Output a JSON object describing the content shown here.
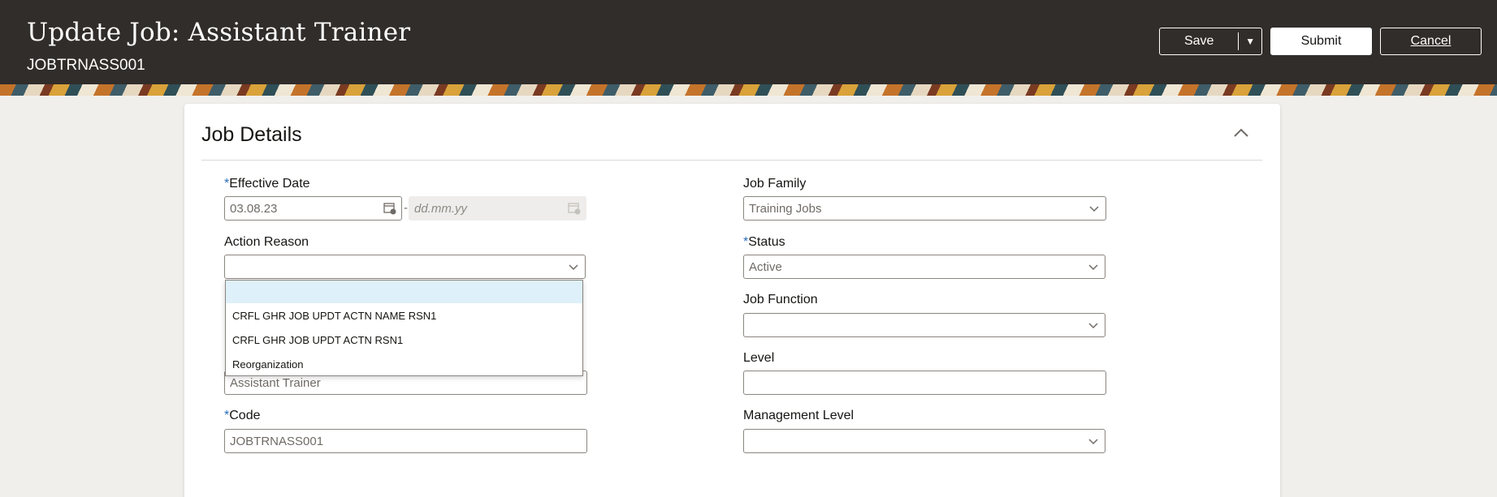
{
  "header": {
    "title": "Update Job: Assistant Trainer",
    "subtitle": "JOBTRNASS001",
    "save_label": "Save",
    "submit_label": "Submit",
    "cancel_label": "Cancel"
  },
  "section": {
    "title": "Job Details"
  },
  "form": {
    "effective_date": {
      "label": "Effective Date",
      "required": "*",
      "value": "03.08.23",
      "end_placeholder": "dd.mm.yy"
    },
    "action_reason": {
      "label": "Action Reason",
      "value": ""
    },
    "name": {
      "value": "Assistant Trainer"
    },
    "code": {
      "label": "Code",
      "required": "*",
      "value": "JOBTRNASS001"
    },
    "job_family": {
      "label": "Job Family",
      "value": "Training Jobs"
    },
    "status": {
      "label": "Status",
      "required": "*",
      "value": "Active"
    },
    "job_function": {
      "label": "Job Function",
      "value": ""
    },
    "level": {
      "label": "Level",
      "value": ""
    },
    "management_level": {
      "label": "Management Level",
      "value": ""
    }
  },
  "action_reason_options": [
    "",
    "CRFL GHR JOB UPDT ACTN NAME RSN1",
    "CRFL GHR JOB UPDT ACTN RSN1",
    "Reorganization"
  ],
  "colors": {
    "header_bg": "#312d2a",
    "required_marker": "#2a6ebb",
    "highlight": "#def0f9"
  }
}
